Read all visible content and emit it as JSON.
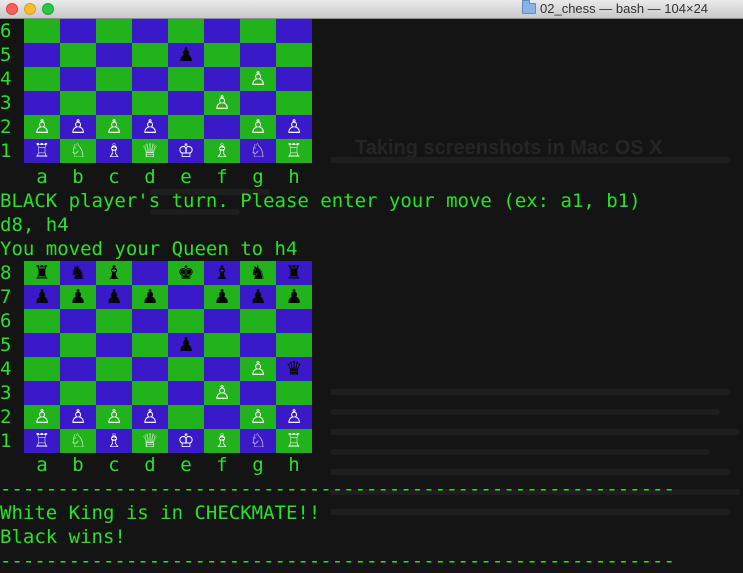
{
  "window": {
    "title": "02_chess — bash — 104×24",
    "folder_icon": "folder-icon"
  },
  "background_ghost": {
    "heading": "Taking screenshots in Mac OS X"
  },
  "colors": {
    "terminal_text": "#27e227",
    "light_square": "#22b21c",
    "dark_square": "#3a19c8",
    "white_piece": "#ffffff",
    "black_piece": "#050505"
  },
  "files": [
    "a",
    "b",
    "c",
    "d",
    "e",
    "f",
    "g",
    "h"
  ],
  "board_top": {
    "ranks": [
      {
        "label": "6",
        "squares": [
          "",
          "",
          "",
          "",
          "",
          "",
          "",
          ""
        ]
      },
      {
        "label": "5",
        "squares": [
          "",
          "",
          "",
          "",
          "♟",
          "",
          "",
          ""
        ]
      },
      {
        "label": "4",
        "squares": [
          "",
          "",
          "",
          "",
          "",
          "",
          "♙",
          ""
        ]
      },
      {
        "label": "3",
        "squares": [
          "",
          "",
          "",
          "",
          "",
          "♙",
          "",
          ""
        ]
      },
      {
        "label": "2",
        "squares": [
          "♙",
          "♙",
          "♙",
          "♙",
          "",
          "",
          "♙",
          "♙"
        ]
      },
      {
        "label": "1",
        "squares": [
          "♖",
          "♘",
          "♗",
          "♕",
          "♔",
          "♗",
          "♘",
          "♖"
        ]
      }
    ]
  },
  "messages": {
    "turn_prompt": "BLACK player's turn. Please enter your move (ex: a1, b1)",
    "user_input": "d8, h4",
    "moved": "You moved your Queen to h4",
    "separator_1": "-----------------------------------------------------------",
    "checkmate": "White King is in CHECKMATE!!",
    "winner": "Black wins!",
    "separator_2": "-----------------------------------------------------------"
  },
  "board_bottom": {
    "ranks": [
      {
        "label": "8",
        "squares": [
          "♜",
          "♞",
          "♝",
          "",
          "♚",
          "♝",
          "♞",
          "♜"
        ]
      },
      {
        "label": "7",
        "squares": [
          "♟",
          "♟",
          "♟",
          "♟",
          "",
          "♟",
          "♟",
          "♟"
        ]
      },
      {
        "label": "6",
        "squares": [
          "",
          "",
          "",
          "",
          "",
          "",
          "",
          ""
        ]
      },
      {
        "label": "5",
        "squares": [
          "",
          "",
          "",
          "",
          "♟",
          "",
          "",
          ""
        ]
      },
      {
        "label": "4",
        "squares": [
          "",
          "",
          "",
          "",
          "",
          "",
          "♙",
          "♛"
        ]
      },
      {
        "label": "3",
        "squares": [
          "",
          "",
          "",
          "",
          "",
          "♙",
          "",
          ""
        ]
      },
      {
        "label": "2",
        "squares": [
          "♙",
          "♙",
          "♙",
          "♙",
          "",
          "",
          "♙",
          "♙"
        ]
      },
      {
        "label": "1",
        "squares": [
          "♖",
          "♘",
          "♗",
          "♕",
          "♔",
          "♗",
          "♘",
          "♖"
        ]
      }
    ]
  }
}
